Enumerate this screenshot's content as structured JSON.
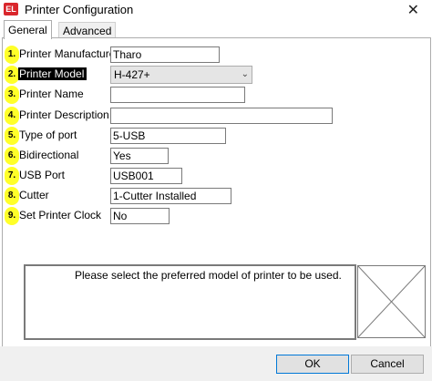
{
  "window": {
    "title": "Printer Configuration",
    "app_icon_text": "EL"
  },
  "tabs": [
    {
      "label": "General"
    },
    {
      "label": "Advanced"
    }
  ],
  "fields": [
    {
      "badge": "1.",
      "label": "Printer Manufacturer",
      "value": "Tharo"
    },
    {
      "badge": "2.",
      "label": "Printer Model",
      "value": "H-427+"
    },
    {
      "badge": "3.",
      "label": "Printer Name",
      "value": ""
    },
    {
      "badge": "4.",
      "label": "Printer Description",
      "value": ""
    },
    {
      "badge": "5.",
      "label": "Type of port",
      "value": "5-USB"
    },
    {
      "badge": "6.",
      "label": "Bidirectional",
      "value": "Yes"
    },
    {
      "badge": "7.",
      "label": "USB Port",
      "value": "USB001"
    },
    {
      "badge": "8.",
      "label": "Cutter",
      "value": "1-Cutter Installed"
    },
    {
      "badge": "9.",
      "label": "Set Printer Clock",
      "value": "No"
    }
  ],
  "description": {
    "text": "Please select the preferred model of printer to be used."
  },
  "buttons": {
    "ok": "OK",
    "cancel": "Cancel"
  }
}
